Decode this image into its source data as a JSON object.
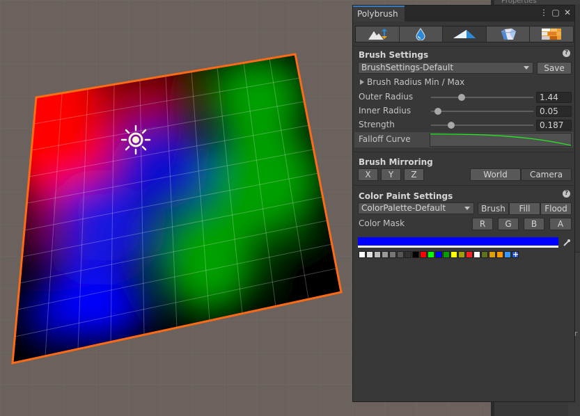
{
  "window": {
    "title": "Polybrush"
  },
  "background_panel": {
    "header_fragment": "Properties",
    "fragment": "Sr"
  },
  "mode_tabs": [
    {
      "name": "raise-lower-mode",
      "icon": "mountain-arrows-icon",
      "active": false
    },
    {
      "name": "smooth-mode",
      "icon": "water-drop-icon",
      "active": false
    },
    {
      "name": "paint-vertex-colors-mode",
      "icon": "paint-brush-icon",
      "active": true
    },
    {
      "name": "scatter-prefabs-mode",
      "icon": "crystal-gem-icon",
      "active": false
    },
    {
      "name": "paint-textures-mode",
      "icon": "texture-bricks-icon",
      "active": false
    }
  ],
  "brush_settings": {
    "title": "Brush Settings",
    "preset": "BrushSettings-Default",
    "save_label": "Save",
    "radius_toggle_label": "Brush Radius Min / Max",
    "outer_radius": {
      "label": "Outer Radius",
      "value": "1.44",
      "fraction": 0.3
    },
    "inner_radius": {
      "label": "Inner Radius",
      "value": "0.05",
      "fraction": 0.07
    },
    "strength": {
      "label": "Strength",
      "value": "0.187",
      "fraction": 0.2
    },
    "falloff_label": "Falloff Curve"
  },
  "brush_mirroring": {
    "title": "Brush Mirroring",
    "axes": [
      "X",
      "Y",
      "Z"
    ],
    "space_world": "World",
    "space_camera": "Camera"
  },
  "color_paint": {
    "title": "Color Paint Settings",
    "palette": "ColorPalette-Default",
    "modes": [
      "Brush",
      "Fill",
      "Flood"
    ],
    "active_mode": "Brush",
    "mask_label": "Color Mask",
    "mask_channels": [
      "R",
      "G",
      "B",
      "A"
    ],
    "current_color": "#0000ff",
    "swatch_colors": [
      "#ffffff",
      "#e0e0e0",
      "#bdbdbd",
      "#9a9a9a",
      "#777777",
      "#555555",
      "#333333",
      "#000000",
      "#ff0000",
      "#00ff00",
      "#0000ff",
      "#00a000",
      "#ffff00",
      "#a0a000",
      "#ff2020",
      "#ffffff",
      "#607020",
      "#e0a000",
      "#ff9900",
      "#3399ff"
    ]
  },
  "colors": {
    "selection_outline": "#ff6a14",
    "scene_background": "#6b625d",
    "active_tab_accent": "#3a79bb"
  }
}
